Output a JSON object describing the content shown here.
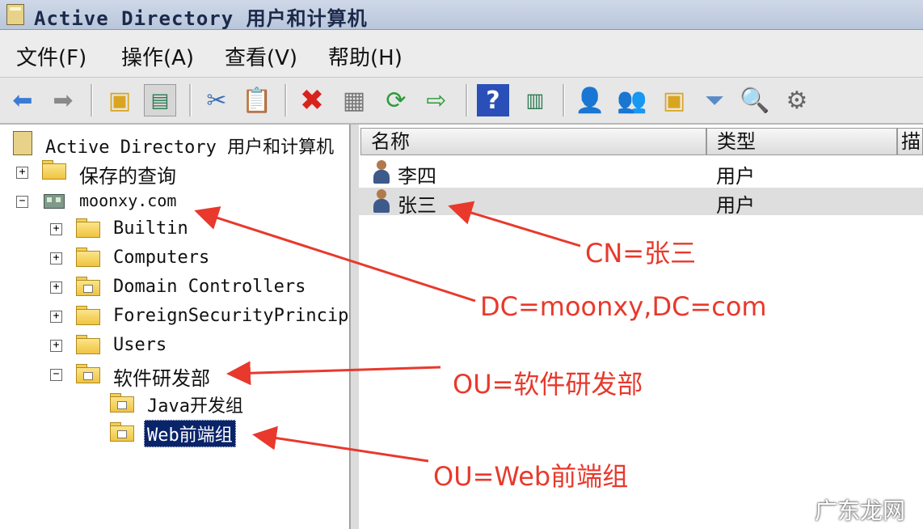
{
  "window": {
    "title": "Active Directory 用户和计算机"
  },
  "menu": {
    "items": [
      "文件(F)",
      "操作(A)",
      "查看(V)",
      "帮助(H)"
    ]
  },
  "toolbar": {
    "icons": [
      "back-icon",
      "forward-icon",
      "up-folder-icon",
      "console-tree-icon",
      "cut-icon",
      "paste-icon",
      "delete-icon",
      "properties-icon",
      "refresh-icon",
      "export-icon",
      "help-icon",
      "show-pane-icon",
      "new-user-icon",
      "new-group-icon",
      "new-ou-icon",
      "filter-icon",
      "find-icon",
      "delegate-icon"
    ]
  },
  "tree": {
    "root": "Active Directory 用户和计算机",
    "saved_queries": "保存的查询",
    "domain": "moonxy.com",
    "children": [
      "Builtin",
      "Computers",
      "Domain Controllers",
      "ForeignSecurityPrincip",
      "Users",
      "软件研发部"
    ],
    "ou_children": [
      "Java开发组",
      "Web前端组"
    ],
    "selected": "Web前端组"
  },
  "list": {
    "columns": [
      "名称",
      "类型",
      "描"
    ],
    "rows": [
      {
        "name": "李四",
        "type": "用户"
      },
      {
        "name": "张三",
        "type": "用户"
      }
    ]
  },
  "annotations": {
    "cn": "CN=张三",
    "dc": "DC=moonxy,DC=com",
    "ou1": "OU=软件研发部",
    "ou2": "OU=Web前端组",
    "color": "#e8392c"
  },
  "watermark": "广东龙网"
}
